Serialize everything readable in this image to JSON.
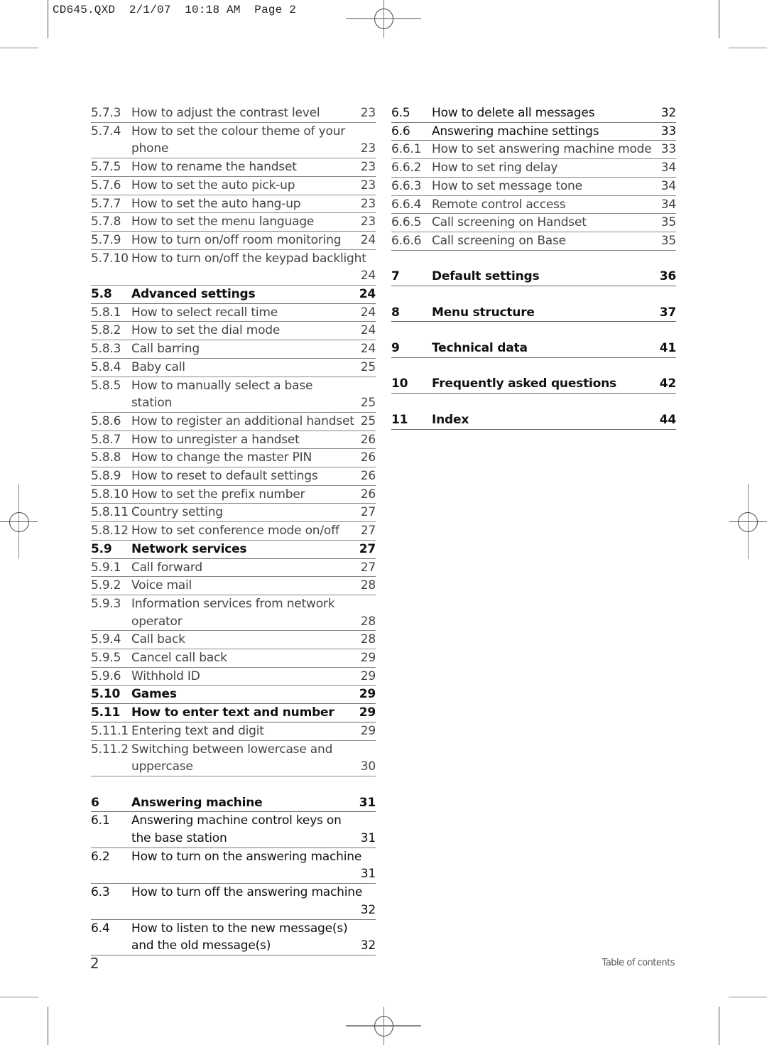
{
  "slug": {
    "file": "CD645.QXD",
    "date": "2/1/07",
    "time": "10:18 AM",
    "page_label": "Page 2"
  },
  "left_column": [
    {
      "num": "5.7.3",
      "title": "How to adjust the contrast level",
      "page": "23",
      "level": "sub"
    },
    {
      "num": "5.7.4",
      "title": "How to set the colour theme of your phone",
      "page": "23",
      "level": "sub"
    },
    {
      "num": "5.7.5",
      "title": "How to rename the handset",
      "page": "23",
      "level": "sub"
    },
    {
      "num": "5.7.6",
      "title": "How to set the auto pick-up",
      "page": "23",
      "level": "sub"
    },
    {
      "num": "5.7.7",
      "title": "How to set the auto hang-up",
      "page": "23",
      "level": "sub"
    },
    {
      "num": "5.7.8",
      "title": "How to set the menu language",
      "page": "23",
      "level": "sub"
    },
    {
      "num": "5.7.9",
      "title": "How to turn on/off room monitoring",
      "page": "24",
      "level": "sub"
    },
    {
      "num": "5.7.10",
      "title": "How to turn on/off the keypad backlight",
      "page": "24",
      "level": "sub",
      "page_on_next_line": true
    },
    {
      "num": "5.8",
      "title": "Advanced settings",
      "page": "24",
      "level": "section"
    },
    {
      "num": "5.8.1",
      "title": "How to select recall time",
      "page": "24",
      "level": "sub"
    },
    {
      "num": "5.8.2",
      "title": "How to set the dial mode",
      "page": "24",
      "level": "sub"
    },
    {
      "num": "5.8.3",
      "title": "Call barring",
      "page": "24",
      "level": "sub"
    },
    {
      "num": "5.8.4",
      "title": "Baby call",
      "page": "25",
      "level": "sub"
    },
    {
      "num": "5.8.5",
      "title": "How to manually select a base station",
      "page": "25",
      "level": "sub"
    },
    {
      "num": "5.8.6",
      "title": "How to register an additional handset",
      "page": "25",
      "level": "sub"
    },
    {
      "num": "5.8.7",
      "title": "How to unregister a handset",
      "page": "26",
      "level": "sub"
    },
    {
      "num": "5.8.8",
      "title": "How to change the master PIN",
      "page": "26",
      "level": "sub"
    },
    {
      "num": "5.8.9",
      "title": "How to reset to default settings",
      "page": "26",
      "level": "sub"
    },
    {
      "num": "5.8.10",
      "title": "How to set the prefix number",
      "page": "26",
      "level": "sub"
    },
    {
      "num": "5.8.11",
      "title": "Country setting",
      "page": "27",
      "level": "sub"
    },
    {
      "num": "5.8.12",
      "title": "How to set conference mode on/off",
      "page": "27",
      "level": "sub"
    },
    {
      "num": "5.9",
      "title": "Network services",
      "page": "27",
      "level": "section"
    },
    {
      "num": "5.9.1",
      "title": "Call forward",
      "page": "27",
      "level": "sub"
    },
    {
      "num": "5.9.2",
      "title": "Voice mail",
      "page": "28",
      "level": "sub"
    },
    {
      "num": "5.9.3",
      "title": "Information services from network operator",
      "page": "28",
      "level": "sub"
    },
    {
      "num": "5.9.4",
      "title": "Call back",
      "page": "28",
      "level": "sub"
    },
    {
      "num": "5.9.5",
      "title": "Cancel call back",
      "page": "29",
      "level": "sub"
    },
    {
      "num": "5.9.6",
      "title": "Withhold ID",
      "page": "29",
      "level": "sub"
    },
    {
      "num": "5.10",
      "title": "Games",
      "page": "29",
      "level": "section"
    },
    {
      "num": "5.11",
      "title": "How to enter text and number",
      "page": "29",
      "level": "section"
    },
    {
      "num": "5.11.1",
      "title": "Entering text and digit",
      "page": "29",
      "level": "sub"
    },
    {
      "num": "5.11.2",
      "title": "Switching between lowercase and uppercase",
      "page": "30",
      "level": "sub"
    },
    {
      "gap": true
    },
    {
      "num": "6",
      "title": "Answering machine",
      "page": "31",
      "level": "chapter"
    },
    {
      "num": "6.1",
      "title": "Answering machine control keys on the base station",
      "page": "31",
      "level": "section-plain"
    },
    {
      "num": "6.2",
      "title": "How to turn on the answering machine",
      "page": "31",
      "level": "section-plain",
      "page_on_next_line": true
    },
    {
      "num": "6.3",
      "title": "How to turn off the answering machine",
      "page": "32",
      "level": "section-plain",
      "page_on_next_line": true
    },
    {
      "num": "6.4",
      "title": "How to listen to the new message(s) and the old message(s)",
      "page": "32",
      "level": "section-plain"
    }
  ],
  "right_column": [
    {
      "num": "6.5",
      "title": "How to delete all messages",
      "page": "32",
      "level": "section-plain"
    },
    {
      "num": "6.6",
      "title": "Answering machine settings",
      "page": "33",
      "level": "section-plain"
    },
    {
      "num": "6.6.1",
      "title": "How to set answering machine mode",
      "page": "33",
      "level": "sub"
    },
    {
      "num": "6.6.2",
      "title": "How to set ring delay",
      "page": "34",
      "level": "sub"
    },
    {
      "num": "6.6.3",
      "title": "How to set message tone",
      "page": "34",
      "level": "sub"
    },
    {
      "num": "6.6.4",
      "title": "Remote control access",
      "page": "34",
      "level": "sub"
    },
    {
      "num": "6.6.5",
      "title": "Call screening on Handset",
      "page": "35",
      "level": "sub"
    },
    {
      "num": "6.6.6",
      "title": "Call screening on Base",
      "page": "35",
      "level": "sub"
    },
    {
      "gap": true
    },
    {
      "num": "7",
      "title": "Default settings",
      "page": "36",
      "level": "chapter"
    },
    {
      "gap": true
    },
    {
      "num": "8",
      "title": "Menu structure",
      "page": "37",
      "level": "chapter"
    },
    {
      "gap": true
    },
    {
      "num": "9",
      "title": "Technical data",
      "page": "41",
      "level": "chapter"
    },
    {
      "gap": true
    },
    {
      "num": "10",
      "title": "Frequently asked questions",
      "page": "42",
      "level": "chapter"
    },
    {
      "gap": true
    },
    {
      "num": "11",
      "title": "Index",
      "page": "44",
      "level": "chapter"
    }
  ],
  "footer": {
    "page_number": "2",
    "section_title": "Table of contents"
  }
}
